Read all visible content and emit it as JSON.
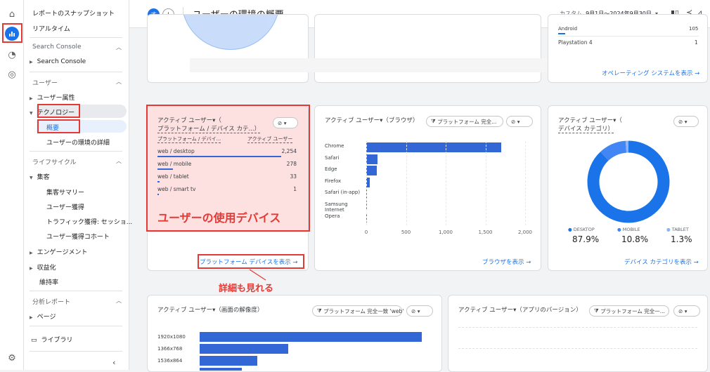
{
  "sidebar": {
    "snapshot": "レポートのスナップショット",
    "realtime": "リアルタイム",
    "search_console_section": "Search Console",
    "search_console_item": "Search Console",
    "user_section": "ユーザー",
    "user_attributes": "ユーザー属性",
    "technology": "テクノロジー",
    "overview": "概要",
    "env_details": "ユーザーの環境の詳細",
    "lifecycle_section": "ライフサイクル",
    "acquisition": "集客",
    "acq_summary": "集客サマリー",
    "user_acq": "ユーザー獲得",
    "traffic_acq": "トラフィック獲得: セッショ...",
    "user_acq_cohort": "ユーザー獲得コホート",
    "engagement": "エンゲージメント",
    "monetization": "収益化",
    "retention": "維持率",
    "analysis_section": "分析レポート",
    "page": "ページ",
    "library": "ライブラリ"
  },
  "topbar": {
    "avatar_letter": "す",
    "title": "ユーザーの環境の概要",
    "date_label": "カスタム",
    "date_range": "9月1日～2024年9月30日"
  },
  "top_cards": {
    "os_rows": [
      {
        "label": "Android",
        "value": "105"
      },
      {
        "label": "Playstation 4",
        "value": "1"
      }
    ],
    "os_link": "オペレーティング システムを表示"
  },
  "platform_card": {
    "title_1": "アクティブ ユーザー▾（",
    "title_2": "プラットフォーム / デバイス カテ...）",
    "col1": "プラットフォーム / デバイ...",
    "col2": "アクティブ ユーザー",
    "rows": [
      {
        "label": "web / desktop",
        "value": "2,254",
        "share": 1.0
      },
      {
        "label": "web / mobile",
        "value": "278",
        "share": 0.123
      },
      {
        "label": "web / tablet",
        "value": "33",
        "share": 0.015
      },
      {
        "label": "web / smart tv",
        "value": "1",
        "share": 0.0004
      }
    ],
    "link": "プラットフォーム デバイスを表示",
    "annotation": "ユーザーの使用デバイス",
    "callout": "詳細も見れる"
  },
  "browser_card": {
    "title": "アクティブ ユーザー▾（ブラウザ）",
    "filter_chip": "プラットフォーム 完全...",
    "link": "ブラウザを表示"
  },
  "device_card": {
    "title_1": "アクティブ ユーザー▾（",
    "title_2": "デバイス カテゴリ）",
    "legend": [
      {
        "label": "DESKTOP",
        "value": "87.9%",
        "color": "#1a73e8"
      },
      {
        "label": "MOBILE",
        "value": "10.8%",
        "color": "#4285f4"
      },
      {
        "label": "TABLET",
        "value": "1.3%",
        "color": "#8ab4f8"
      }
    ],
    "link": "デバイス カテゴリを表示"
  },
  "resolution_card": {
    "title": "アクティブ ユーザー▾（画面の解像度）",
    "filter_chip": "プラットフォーム 完全一致 'web'",
    "rows": [
      {
        "label": "1920x1080",
        "value": 1.0
      },
      {
        "label": "1366x768",
        "value": 0.4
      },
      {
        "label": "1536x864",
        "value": 0.26
      }
    ]
  },
  "appver_card": {
    "title": "アクティブ ユーザー▾（アプリのバージョン）",
    "filter_chip": "プラットフォーム 完全一..."
  },
  "chart_data": {
    "type": "bar",
    "title": "アクティブ ユーザー（ブラウザ）",
    "categories": [
      "Chrome",
      "Safari",
      "Edge",
      "Firefox",
      "Safari (in-app)",
      "Samsung Internet",
      "Opera"
    ],
    "values": [
      1700,
      140,
      130,
      45,
      4,
      3,
      2
    ],
    "xlim": [
      0,
      2000
    ],
    "xticks": [
      "0",
      "500",
      "1,000",
      "1,500",
      "2,000"
    ],
    "color": "#3367d6"
  },
  "accent": "#1a73e8",
  "highlight_red": "#e53935"
}
